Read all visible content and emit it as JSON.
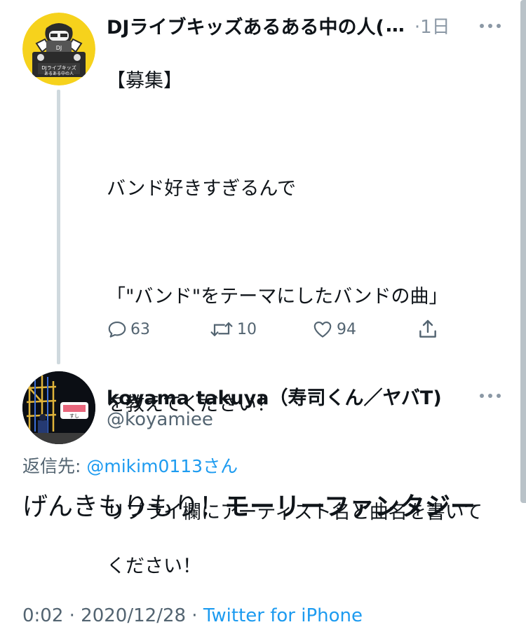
{
  "parent_tweet": {
    "avatar": "dj-live-kids-avatar",
    "name": "DJライブキッズあるある中の人(",
    "name_ellipsis": "…",
    "timestamp": "·1日",
    "lines": [
      "【募集】",
      "",
      "バンド好きすぎるんで",
      "",
      "「\"バンド\"をテーマにしたバンドの曲」",
      "",
      "を教えてください！",
      "",
      "リプライ欄にアーティスト名と曲名を書いて",
      "ください！"
    ],
    "actions": {
      "reply_count": "63",
      "retweet_count": "10",
      "like_count": "94"
    },
    "more_icon": "more-horizontal-icon"
  },
  "reply_tweet": {
    "avatar": "koyamiee-avatar",
    "name": "koyama takuya（寿司くん／ヤバT)",
    "handle": "@koyamiee",
    "replying_label": "返信先: ",
    "replying_mention": "@mikim0113さん",
    "body_plain": "げんきもりもり！",
    "body_bold": "モーリーファンタジー",
    "time": "0:02 · 2020/12/28 · ",
    "source": "Twitter for iPhone",
    "more_icon": "more-horizontal-icon"
  },
  "colors": {
    "text": "#0f1419",
    "secondary": "#536471",
    "link": "#1d9bf0",
    "thread_line": "#cfd9de"
  }
}
